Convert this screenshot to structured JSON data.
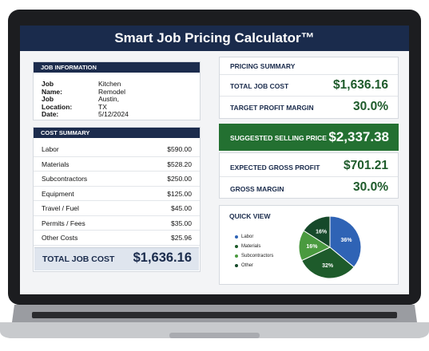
{
  "app": {
    "title": "Smart Job Pricing Calculator™"
  },
  "job_info": {
    "header": "JOB INFORMATION",
    "fields": [
      {
        "label": "Job Name:",
        "value": "Kitchen Remodel"
      },
      {
        "label": "Job Location:",
        "value": "Austin, TX"
      },
      {
        "label": "Date:",
        "value": "5/12/2024"
      }
    ]
  },
  "cost_summary": {
    "header": "COST SUMMARY",
    "rows": [
      {
        "name": "Labor",
        "amount": "$590.00"
      },
      {
        "name": "Materials",
        "amount": "$528.20"
      },
      {
        "name": "Subcontractors",
        "amount": "$250.00"
      },
      {
        "name": "Equipment",
        "amount": "$125.00"
      },
      {
        "name": "Travel / Fuel",
        "amount": "$45.00"
      },
      {
        "name": "Permits / Fees",
        "amount": "$35.00"
      },
      {
        "name": "Other Costs",
        "amount": "$25.96"
      }
    ],
    "total_label": "TOTAL JOB COST",
    "total_value": "$1,636.16"
  },
  "pricing_summary": {
    "header": "PRICING SUMMARY",
    "total_job_cost_label": "TOTAL JOB COST",
    "total_job_cost_value": "$1,636.16",
    "target_margin_label": "TARGET PROFIT MARGIN",
    "target_margin_value": "30.0%",
    "suggested_price_label": "SUGGESTED SELLING PRICE",
    "suggested_price_value": "$2,337.38",
    "gross_profit_label": "EXPECTED GROSS PROFIT",
    "gross_profit_value": "$701.21",
    "gross_margin_label": "GROSS MARGIN",
    "gross_margin_value": "30.0%"
  },
  "quick_view": {
    "header": "QUICK VIEW",
    "legend": [
      {
        "name": "Labor",
        "color": "#2f63b5"
      },
      {
        "name": "Materials",
        "color": "#1e5b2b"
      },
      {
        "name": "Subcontractors",
        "color": "#4a9a3f"
      },
      {
        "name": "Other",
        "color": "#16492a"
      }
    ]
  },
  "chart_data": {
    "type": "pie",
    "title": "QUICK VIEW",
    "slices": [
      {
        "name": "Labor",
        "value": 36,
        "label": "36%",
        "color": "#2f63b5"
      },
      {
        "name": "Materials",
        "value": 32,
        "label": "32%",
        "color": "#1e5b2b"
      },
      {
        "name": "Subcontractors",
        "value": 16,
        "label": "16%",
        "color": "#4a9a3f"
      },
      {
        "name": "Other",
        "value": 16,
        "label": "16%",
        "color": "#16492a"
      }
    ],
    "legend_position": "left"
  }
}
